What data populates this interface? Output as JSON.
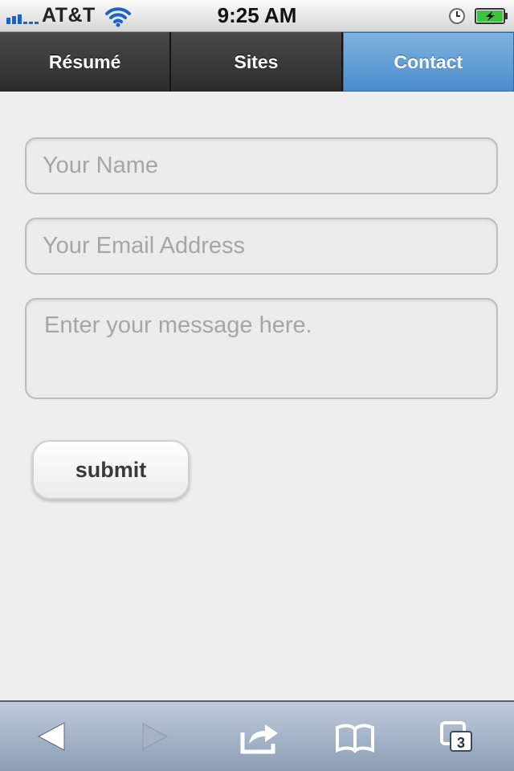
{
  "status_bar": {
    "carrier": "AT&T",
    "time": "9:25 AM",
    "signal_icon": "signal-icon",
    "wifi_icon": "wifi-icon",
    "alarm_icon": "alarm-icon",
    "battery_icon": "battery-charging-icon"
  },
  "nav": {
    "tabs": [
      {
        "label": "Résumé",
        "active": false
      },
      {
        "label": "Sites",
        "active": false
      },
      {
        "label": "Contact",
        "active": true
      }
    ],
    "active_color": "#5a9ad3"
  },
  "form": {
    "name_placeholder": "Your Name",
    "name_value": "",
    "email_placeholder": "Your Email Address",
    "email_value": "",
    "message_placeholder": "Enter your message here.",
    "message_value": "",
    "submit_label": "submit"
  },
  "toolbar": {
    "back_icon": "back-arrow-icon",
    "forward_icon": "forward-arrow-icon",
    "share_icon": "share-icon",
    "bookmarks_icon": "bookmarks-icon",
    "pages_icon": "pages-icon",
    "pages_count": "3"
  }
}
